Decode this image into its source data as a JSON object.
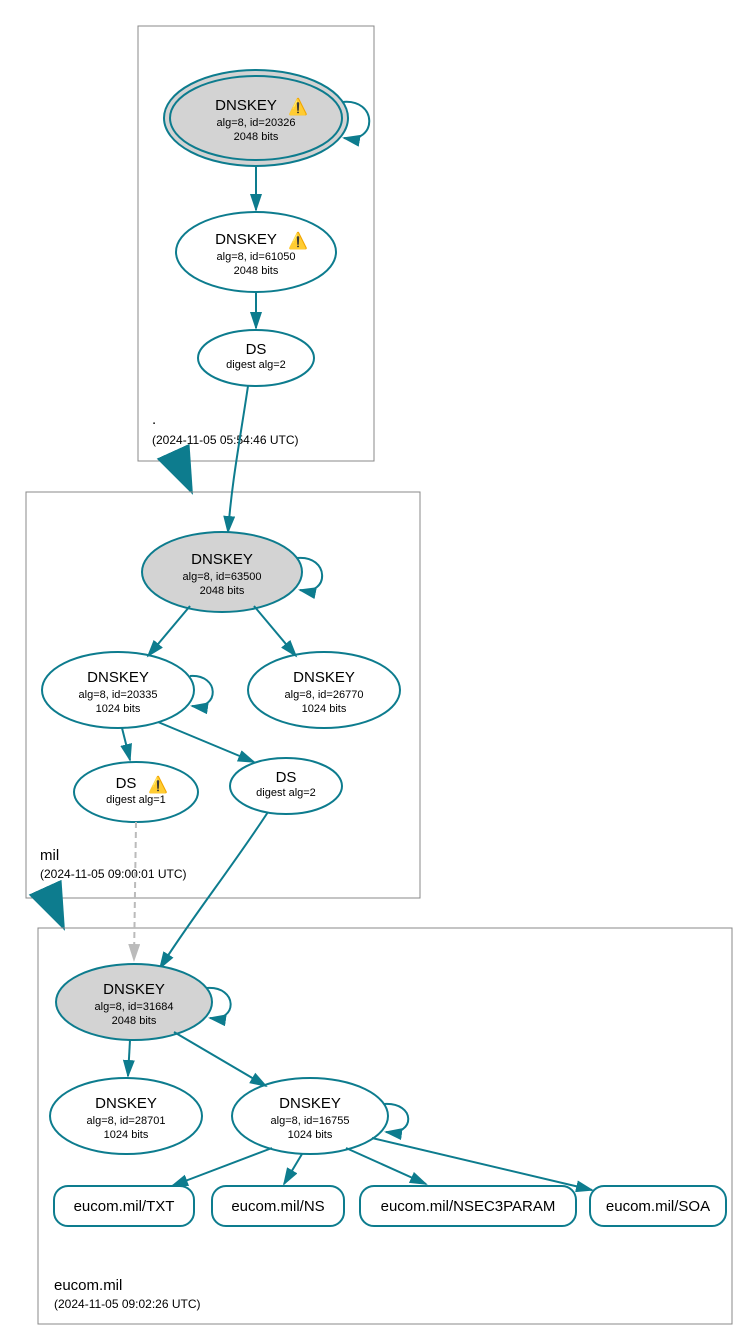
{
  "zones": {
    "root": {
      "label": ".",
      "timestamp": "(2024-11-05 05:54:46 UTC)"
    },
    "mil": {
      "label": "mil",
      "timestamp": "(2024-11-05 09:00:01 UTC)"
    },
    "eucom": {
      "label": "eucom.mil",
      "timestamp": "(2024-11-05 09:02:26 UTC)"
    }
  },
  "nodes": {
    "root_ksk": {
      "title": "DNSKEY",
      "line1": "alg=8, id=20326",
      "line2": "2048 bits",
      "warn": "⚠️"
    },
    "root_zsk": {
      "title": "DNSKEY",
      "line1": "alg=8, id=61050",
      "line2": "2048 bits",
      "warn": "⚠️"
    },
    "root_ds": {
      "title": "DS",
      "line1": "digest alg=2"
    },
    "mil_ksk": {
      "title": "DNSKEY",
      "line1": "alg=8, id=63500",
      "line2": "2048 bits"
    },
    "mil_zsk1": {
      "title": "DNSKEY",
      "line1": "alg=8, id=20335",
      "line2": "1024 bits"
    },
    "mil_zsk2": {
      "title": "DNSKEY",
      "line1": "alg=8, id=26770",
      "line2": "1024 bits"
    },
    "mil_ds1": {
      "title": "DS",
      "line1": "digest alg=1",
      "warn": "⚠️"
    },
    "mil_ds2": {
      "title": "DS",
      "line1": "digest alg=2"
    },
    "eu_ksk": {
      "title": "DNSKEY",
      "line1": "alg=8, id=31684",
      "line2": "2048 bits"
    },
    "eu_zsk1": {
      "title": "DNSKEY",
      "line1": "alg=8, id=28701",
      "line2": "1024 bits"
    },
    "eu_zsk2": {
      "title": "DNSKEY",
      "line1": "alg=8, id=16755",
      "line2": "1024 bits"
    },
    "rr_txt": {
      "title": "eucom.mil/TXT"
    },
    "rr_ns": {
      "title": "eucom.mil/NS"
    },
    "rr_nsec3": {
      "title": "eucom.mil/NSEC3PARAM"
    },
    "rr_soa": {
      "title": "eucom.mil/SOA"
    }
  }
}
